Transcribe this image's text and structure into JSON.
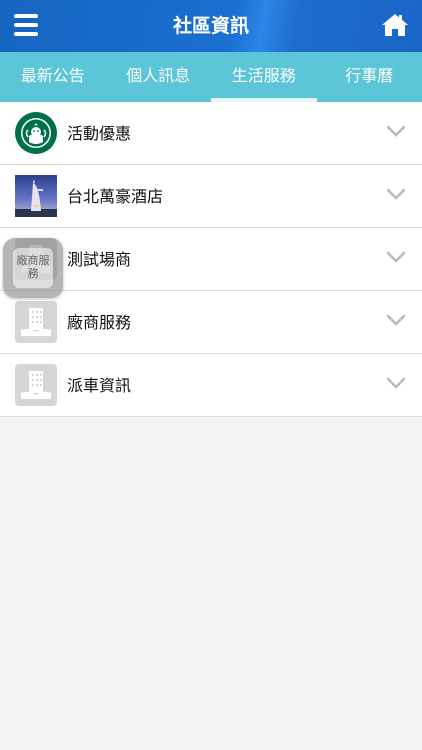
{
  "header": {
    "title": "社區資訊",
    "menu_icon": "hamburger-menu-icon",
    "home_icon": "home-icon"
  },
  "tabs": [
    {
      "label": "最新公告",
      "active": false
    },
    {
      "label": "個人訊息",
      "active": false
    },
    {
      "label": "生活服務",
      "active": true
    },
    {
      "label": "行事曆",
      "active": false
    }
  ],
  "list": [
    {
      "label": "活動優惠",
      "thumb": "starbucks-logo"
    },
    {
      "label": "台北萬豪酒店",
      "thumb": "hotel-photo"
    },
    {
      "label": "測試場商",
      "thumb": "building-icon"
    },
    {
      "label": "廠商服務",
      "thumb": "building-icon"
    },
    {
      "label": "派車資訊",
      "thumb": "building-icon"
    }
  ],
  "floating_badge": {
    "text": "廠商服務"
  },
  "colors": {
    "header": "#1a6fd1",
    "tabs": "#5cc5d8",
    "background": "#f2f2f2"
  }
}
